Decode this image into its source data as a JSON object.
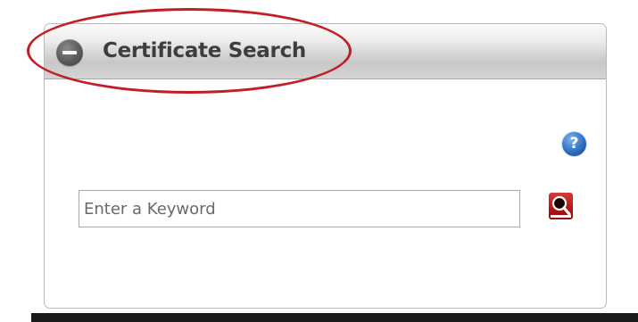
{
  "panel": {
    "title": "Certificate Search",
    "collapse_icon": "minus-circle-icon",
    "help_icon": "help-icon",
    "help_glyph": "?"
  },
  "search": {
    "placeholder": "Enter a Keyword",
    "value": "",
    "button_icon": "magnifier-icon"
  },
  "colors": {
    "highlight_ellipse": "#c21e25",
    "search_button": "#b81717",
    "help_button": "#2f6fc4"
  }
}
